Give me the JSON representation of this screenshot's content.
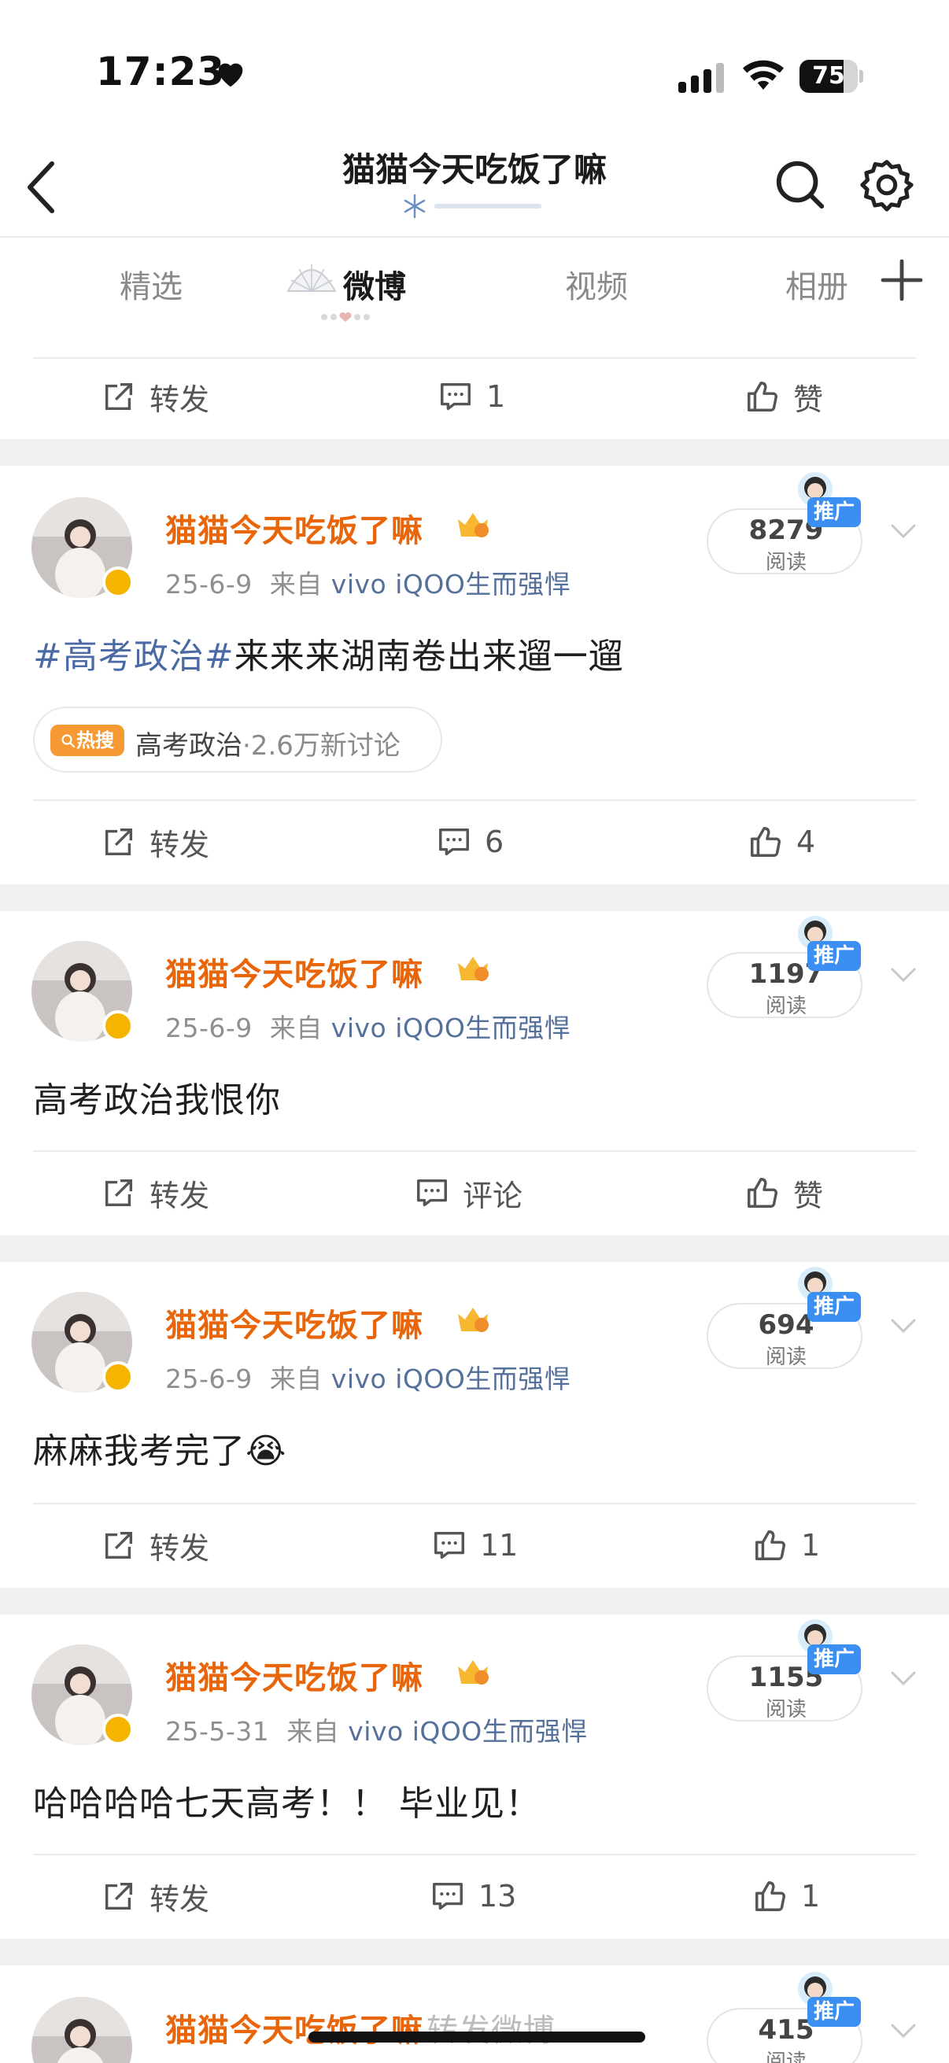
{
  "status_bar": {
    "time": "17:23",
    "battery": "75",
    "battery_level": 0.75
  },
  "header": {
    "title": "猫猫今天吃饭了嘛"
  },
  "tabs": [
    {
      "label": "精选"
    },
    {
      "label": "微博"
    },
    {
      "label": "视频"
    },
    {
      "label": "相册"
    }
  ],
  "top_actions": {
    "forward": "转发",
    "comment": "1",
    "like": "赞"
  },
  "posts": [
    {
      "user": "猫猫今天吃饭了嘛",
      "date": "25-6-9",
      "from": "来自",
      "source": "vivo iQOO生而强悍",
      "reads": "8279",
      "reads_label": "阅读",
      "promo": "推广",
      "hashtag": "#高考政治#",
      "text": "来来来湖南卷出来遛一遛",
      "hot": {
        "badge": "热搜",
        "topic": "高考政治",
        "discussion": "·2.6万新讨论"
      },
      "actions": {
        "forward": "转发",
        "comment": "6",
        "like": "4"
      }
    },
    {
      "user": "猫猫今天吃饭了嘛",
      "date": "25-6-9",
      "from": "来自",
      "source": "vivo iQOO生而强悍",
      "reads": "1197",
      "reads_label": "阅读",
      "promo": "推广",
      "text": "高考政治我恨你",
      "actions": {
        "forward": "转发",
        "comment": "评论",
        "like": "赞"
      }
    },
    {
      "user": "猫猫今天吃饭了嘛",
      "date": "25-6-9",
      "from": "来自",
      "source": "vivo iQOO生而强悍",
      "reads": "694",
      "reads_label": "阅读",
      "promo": "推广",
      "text": "麻麻我考完了",
      "emoji": "😭",
      "actions": {
        "forward": "转发",
        "comment": "11",
        "like": "1"
      }
    },
    {
      "user": "猫猫今天吃饭了嘛",
      "date": "25-5-31",
      "from": "来自",
      "source": "vivo iQOO生而强悍",
      "reads": "1155",
      "reads_label": "阅读",
      "promo": "推广",
      "text": "哈哈哈哈七天高考！！ 毕业见！",
      "actions": {
        "forward": "转发",
        "comment": "13",
        "like": "1"
      }
    },
    {
      "user": "猫猫今天吃饭了嘛",
      "forward_tag": "转发微博",
      "reads": "415",
      "reads_label": "阅读",
      "promo": "推广"
    }
  ],
  "colors": {
    "username": "#e8650a",
    "link": "#4b6aa4",
    "promo": "#3b8ff3",
    "hot": "#f59a32",
    "vip": "#f5b400"
  },
  "icons": [
    "heart-icon",
    "signal-icon",
    "wifi-icon",
    "battery-icon",
    "back-arrow-icon",
    "search-icon",
    "gear-icon",
    "plus-icon",
    "forward-icon",
    "comment-icon",
    "like-icon",
    "chevron-down-icon",
    "verified-icon",
    "vip-crown-icon",
    "search-small-icon"
  ]
}
